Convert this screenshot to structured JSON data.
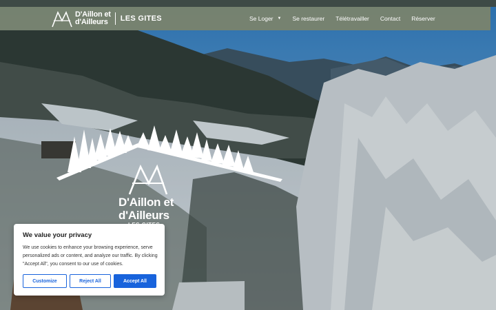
{
  "header": {
    "brand_line1": "D'Aillon et",
    "brand_line2": "d'Ailleurs",
    "brand_sub": "LES GITES",
    "nav": [
      {
        "label": "Se Loger",
        "has_dropdown": true
      },
      {
        "label": "Se restaurer"
      },
      {
        "label": "Télétravailler"
      },
      {
        "label": "Contact"
      },
      {
        "label": "Réserver"
      }
    ]
  },
  "hero_logo": {
    "line1": "D'Aillon et",
    "line2": "d'Ailleurs",
    "line3": "LES GITES"
  },
  "cookie": {
    "title": "We value your privacy",
    "text": "We use cookies to enhance your browsing experience, serve personalized ads or content, and analyze our traffic. By clicking \"Accept All\", you consent to our use of cookies.",
    "customize": "Customize",
    "reject": "Reject All",
    "accept": "Accept All"
  },
  "colors": {
    "header_bg": "#808468",
    "button_blue": "#1863dc"
  },
  "icons": {
    "caret": "chevron-down-icon"
  }
}
